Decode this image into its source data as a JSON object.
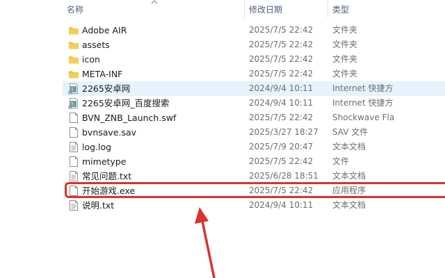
{
  "columns": {
    "name": "名称",
    "date": "修改日期",
    "type": "类型"
  },
  "files": [
    {
      "name": "Adobe AIR",
      "date": "2025/7/5 22:42",
      "type": "文件夹",
      "icon": "folder-icon"
    },
    {
      "name": "assets",
      "date": "2025/7/5 22:42",
      "type": "文件夹",
      "icon": "folder-icon"
    },
    {
      "name": "icon",
      "date": "2025/7/5 22:42",
      "type": "文件夹",
      "icon": "folder-icon"
    },
    {
      "name": "META-INF",
      "date": "2025/7/5 22:42",
      "type": "文件夹",
      "icon": "folder-icon"
    },
    {
      "name": "2265安卓网",
      "date": "2024/9/4 10:11",
      "type": "Internet 快捷方",
      "icon": "internet-shortcut-icon"
    },
    {
      "name": "2265安卓网_百度搜索",
      "date": "2024/9/4 10:11",
      "type": "Internet 快捷方",
      "icon": "internet-shortcut-icon"
    },
    {
      "name": "BVN_ZNB_Launch.swf",
      "date": "2025/7/5 22:42",
      "type": "Shockwave Fla",
      "icon": "file-icon"
    },
    {
      "name": "bvnsave.sav",
      "date": "2025/3/27 18:27",
      "type": "SAV 文件",
      "icon": "file-icon"
    },
    {
      "name": "log.log",
      "date": "2025/7/9 20:47",
      "type": "文本文档",
      "icon": "text-file-icon"
    },
    {
      "name": "mimetype",
      "date": "2025/7/5 22:42",
      "type": "文件",
      "icon": "file-icon"
    },
    {
      "name": "常见问题.txt",
      "date": "2025/6/28 18:51",
      "type": "文本文档",
      "icon": "text-file-icon"
    },
    {
      "name": "开始游戏.exe",
      "date": "2025/7/5 22:42",
      "type": "应用程序",
      "icon": "file-icon"
    },
    {
      "name": "说明.txt",
      "date": "2024/9/4 10:11",
      "type": "文本文档",
      "icon": "text-file-icon"
    }
  ],
  "selected_row_index": 4,
  "highlighted_row_index": 11,
  "colors": {
    "highlight": "#d9332b",
    "selection": "#e5f3ff",
    "folder": "#f3c94a"
  }
}
